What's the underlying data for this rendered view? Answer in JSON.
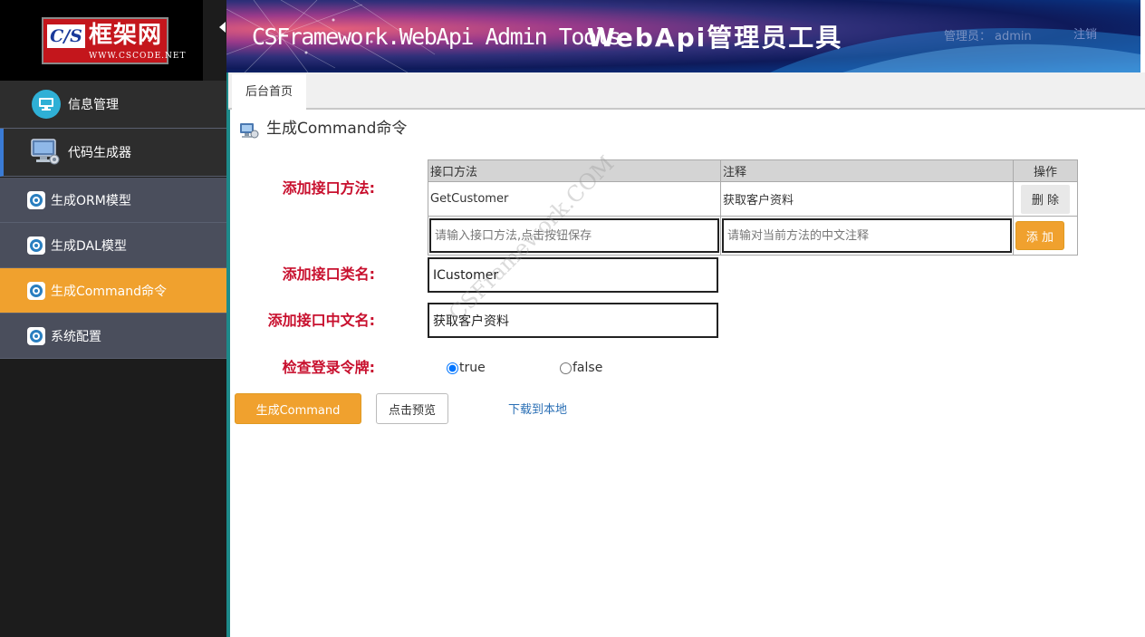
{
  "logo": {
    "badge": "C/S",
    "name": "框架网",
    "url": "WWW.CSCODE.NET"
  },
  "header": {
    "title_en": "CSFramework.WebApi Admin Tools",
    "title_cn": "WebApi管理员工具",
    "admin_label": "管理员：",
    "admin_name": "admin",
    "logout": "注销"
  },
  "sidebar": {
    "items": [
      {
        "label": "信息管理",
        "icon": "info-globe-icon"
      },
      {
        "label": "代码生成器",
        "icon": "monitor-icon",
        "selected": true
      },
      {
        "label": "生成ORM模型",
        "icon": "gear-icon"
      },
      {
        "label": "生成DAL模型",
        "icon": "gear-icon"
      },
      {
        "label": "生成Command命令",
        "icon": "gear-icon",
        "active": true
      },
      {
        "label": "系统配置",
        "icon": "gear-icon"
      }
    ]
  },
  "tabs": [
    {
      "label": "后台首页",
      "active": true
    }
  ],
  "page": {
    "title": "生成Command命令",
    "icon": "monitor-small-icon"
  },
  "form": {
    "labels": {
      "method": "添加接口方法:",
      "class_name": "添加接口类名:",
      "cn_name": "添加接口中文名:",
      "check_token": "检查登录令牌:"
    },
    "table": {
      "headers": [
        "接口方法",
        "注释",
        "操作"
      ],
      "rows": [
        {
          "method": "GetCustomer",
          "comment": "获取客户资料",
          "action": "删 除"
        }
      ],
      "method_placeholder": "请输入接口方法,点击按钮保存",
      "comment_placeholder": "请输对当前方法的中文注释",
      "add_label": "添 加"
    },
    "class_name_value": "ICustomer",
    "cn_name_value": "获取客户资料",
    "radio": {
      "true_label": "true",
      "false_label": "false",
      "selected": "true"
    },
    "buttons": {
      "generate": "生成Command",
      "preview": "点击预览",
      "download": "下载到本地"
    }
  },
  "watermark": "CSFramework.COM",
  "colors": {
    "accent": "#f0a12e",
    "label_red": "#c8102e",
    "sidebar_dark": "#1c1c1c",
    "sidebar_sub": "#4a4e5c"
  }
}
